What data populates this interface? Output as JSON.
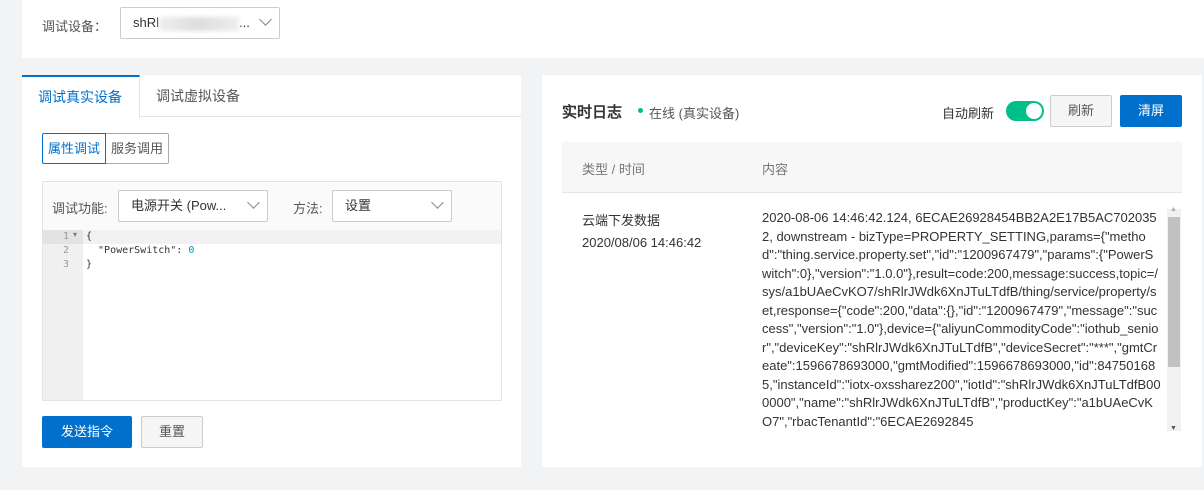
{
  "top": {
    "device_label": "调试设备：",
    "device_value": "shRl",
    "device_suffix": "..."
  },
  "left": {
    "tabs": [
      "调试真实设备",
      "调试虚拟设备"
    ],
    "segments": [
      "属性调试",
      "服务调用"
    ],
    "function_label": "调试功能:",
    "function_value": "电源开关 (Pow...",
    "method_label": "方法:",
    "method_value": "设置",
    "code": {
      "line_numbers": [
        "1",
        "2",
        "3"
      ],
      "lines": [
        "{",
        "  \"PowerSwitch\": ",
        "}"
      ],
      "value": "0"
    },
    "send_button": "发送指令",
    "reset_button": "重置"
  },
  "right": {
    "title": "实时日志",
    "status": "在线 (真实设备)",
    "auto_refresh_label": "自动刷新",
    "auto_refresh_on": true,
    "refresh_button": "刷新",
    "clear_button": "清屏",
    "columns": [
      "类型 / 时间",
      "内容"
    ],
    "rows": [
      {
        "type": "云端下发数据",
        "time": "2020/08/06 14:46:42",
        "content": "2020-08-06 14:46:42.124, 6ECAE26928454BB2A2E17B5AC7020352, downstream - bizType=PROPERTY_SETTING,params={\"method\":\"thing.service.property.set\",\"id\":\"1200967479\",\"params\":{\"PowerSwitch\":0},\"version\":\"1.0.0\"},result=code:200,message:success,topic=/sys/a1bUAeCvKO7/shRlrJWdk6XnJTuLTdfB/thing/service/property/set,response={\"code\":200,\"data\":{},\"id\":\"1200967479\",\"message\":\"success\",\"version\":\"1.0\"},device={\"aliyunCommodityCode\":\"iothub_senior\",\"deviceKey\":\"shRlrJWdk6XnJTuLTdfB\",\"deviceSecret\":\"***\",\"gmtCreate\":1596678693000,\"gmtModified\":1596678693000,\"id\":847501685,\"instanceId\":\"iotx-oxssharez200\",\"iotId\":\"shRlrJWdk6XnJTuLTdfB000000\",\"name\":\"shRlrJWdk6XnJTuLTdfB\",\"productKey\":\"a1bUAeCvKO7\",\"rbacTenantId\":\"6ECAE2692845"
      }
    ]
  }
}
